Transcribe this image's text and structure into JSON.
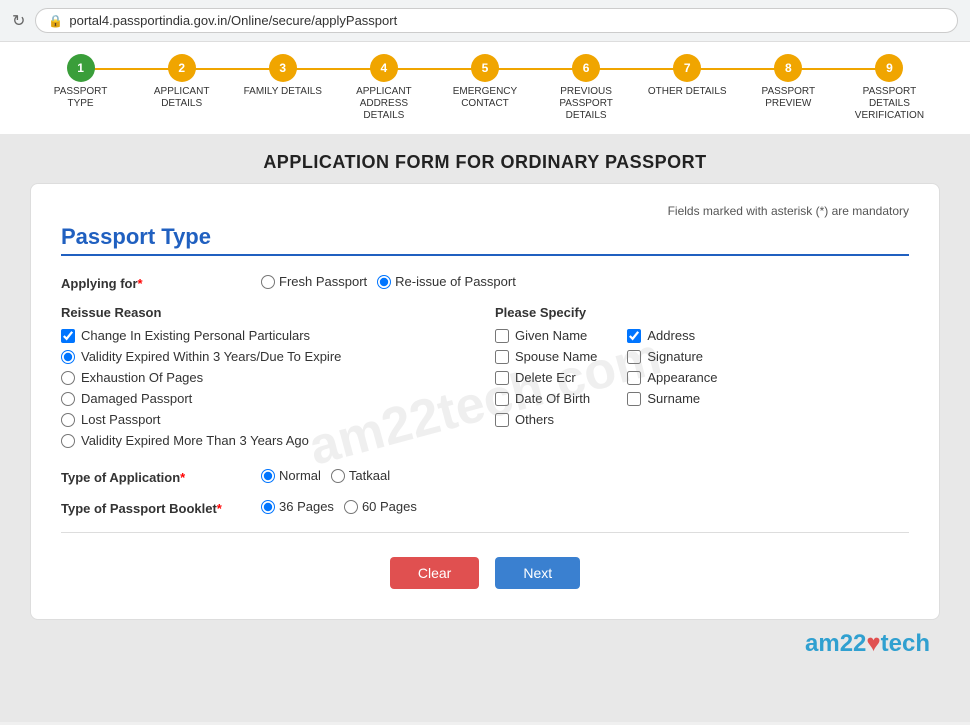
{
  "browser": {
    "url": "portal4.passportindia.gov.in/Online/secure/applyPassport",
    "refresh_icon": "↻",
    "lock_icon": "🔒"
  },
  "progress": {
    "steps": [
      {
        "number": "1",
        "label": "PASSPORT TYPE",
        "state": "completed"
      },
      {
        "number": "2",
        "label": "APPLICANT DETAILS",
        "state": "active"
      },
      {
        "number": "3",
        "label": "FAMILY DETAILS",
        "state": "active"
      },
      {
        "number": "4",
        "label": "APPLICANT ADDRESS DETAILS",
        "state": "active"
      },
      {
        "number": "5",
        "label": "EMERGENCY CONTACT",
        "state": "active"
      },
      {
        "number": "6",
        "label": "PREVIOUS PASSPORT DETAILS",
        "state": "active"
      },
      {
        "number": "7",
        "label": "OTHER DETAILS",
        "state": "active"
      },
      {
        "number": "8",
        "label": "PASSPORT PREVIEW",
        "state": "active"
      },
      {
        "number": "9",
        "label": "PASSPORT DETAILS VERIFICATION",
        "state": "active"
      }
    ]
  },
  "page": {
    "main_title": "APPLICATION FORM FOR ORDINARY PASSPORT",
    "mandatory_note": "Fields marked with asterisk (*) are mandatory"
  },
  "form": {
    "section_title": "Passport Type",
    "applying_for_label": "Applying for",
    "applying_for_required": "*",
    "options_applying": [
      {
        "id": "fresh",
        "label": "Fresh Passport",
        "checked": false
      },
      {
        "id": "reissue",
        "label": "Re-issue of Passport",
        "checked": true
      }
    ],
    "reissue_reason_title": "Reissue Reason",
    "reissue_options": [
      {
        "id": "change",
        "label": "Change In Existing Personal Particulars",
        "type": "checkbox",
        "checked": true
      },
      {
        "id": "validity3",
        "label": "Validity Expired Within 3 Years/Due To Expire",
        "type": "radio",
        "checked": true
      },
      {
        "id": "exhaustion",
        "label": "Exhaustion Of Pages",
        "type": "radio",
        "checked": false
      },
      {
        "id": "damaged",
        "label": "Damaged Passport",
        "type": "radio",
        "checked": false
      },
      {
        "id": "lost",
        "label": "Lost Passport",
        "type": "radio",
        "checked": false
      },
      {
        "id": "validity3plus",
        "label": "Validity Expired More Than 3 Years Ago",
        "type": "radio",
        "checked": false
      }
    ],
    "please_specify_title": "Please Specify",
    "specify_col1": [
      {
        "id": "given_name",
        "label": "Given Name",
        "checked": false
      },
      {
        "id": "spouse_name",
        "label": "Spouse Name",
        "checked": false
      },
      {
        "id": "delete_ecr",
        "label": "Delete Ecr",
        "checked": false
      },
      {
        "id": "date_of_birth",
        "label": "Date Of Birth",
        "checked": false
      },
      {
        "id": "others",
        "label": "Others",
        "checked": false
      }
    ],
    "specify_col2": [
      {
        "id": "address",
        "label": "Address",
        "checked": true
      },
      {
        "id": "signature",
        "label": "Signature",
        "checked": false
      },
      {
        "id": "appearance",
        "label": "Appearance",
        "checked": false
      },
      {
        "id": "surname",
        "label": "Surname",
        "checked": false
      }
    ],
    "type_of_application_label": "Type of Application",
    "type_of_application_required": "*",
    "application_options": [
      {
        "id": "normal",
        "label": "Normal",
        "checked": true
      },
      {
        "id": "tatkaal",
        "label": "Tatkaal",
        "checked": false
      }
    ],
    "type_of_booklet_label": "Type of Passport Booklet",
    "type_of_booklet_required": "*",
    "booklet_options": [
      {
        "id": "36pages",
        "label": "36 Pages",
        "checked": true
      },
      {
        "id": "60pages",
        "label": "60 Pages",
        "checked": false
      }
    ],
    "btn_clear": "Clear",
    "btn_next": "Next"
  },
  "watermark": {
    "text": "am22tech.com"
  },
  "brand": {
    "text_before": "am22",
    "heart": "♥",
    "text_after": "tech"
  }
}
